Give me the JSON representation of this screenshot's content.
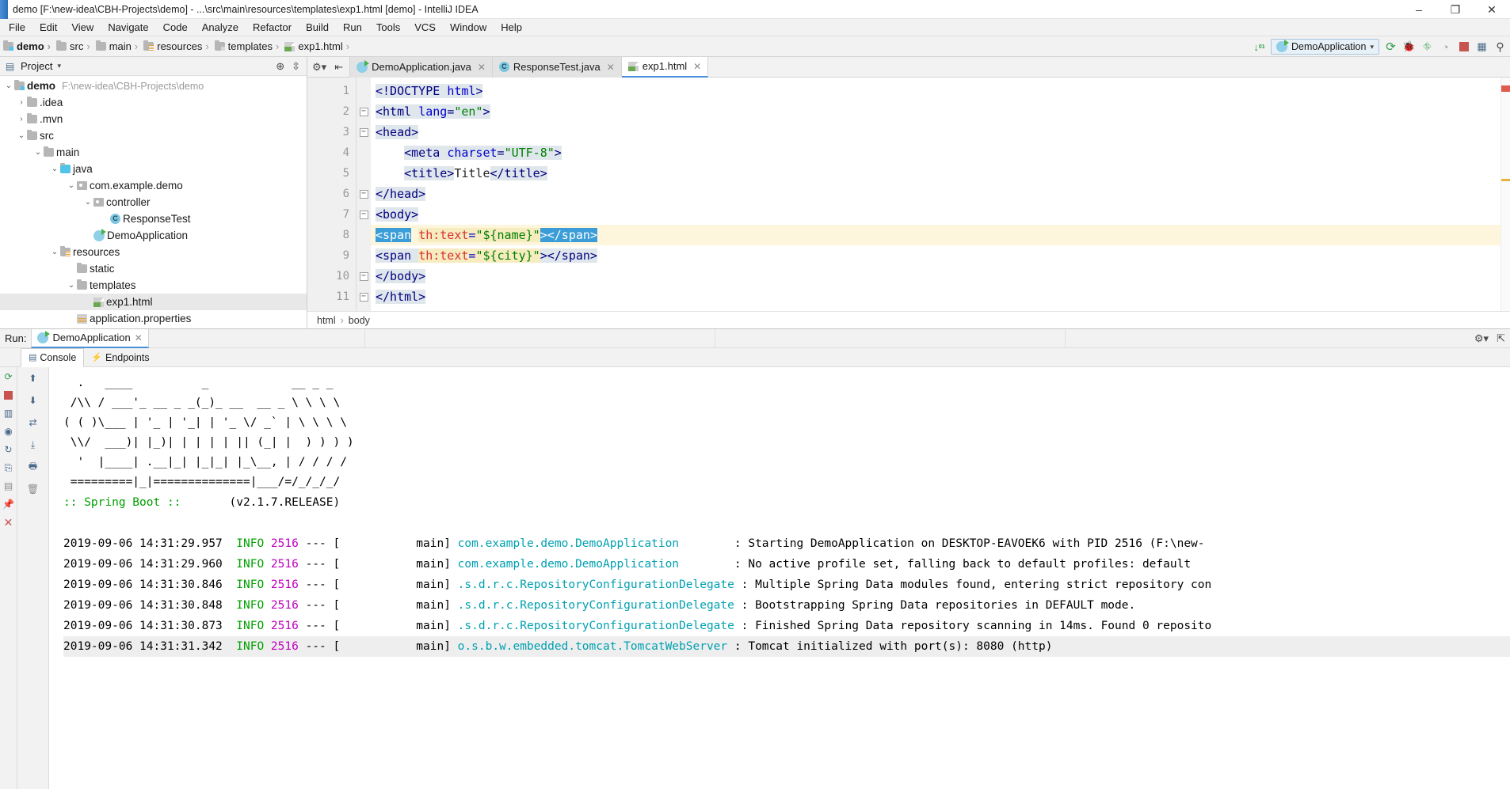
{
  "window": {
    "title": "demo [F:\\new-idea\\CBH-Projects\\demo] - ...\\src\\main\\resources\\templates\\exp1.html [demo] - IntelliJ IDEA",
    "minimize": "–",
    "maximize": "❐",
    "close": "✕"
  },
  "menubar": [
    "File",
    "Edit",
    "View",
    "Navigate",
    "Code",
    "Analyze",
    "Refactor",
    "Build",
    "Run",
    "Tools",
    "VCS",
    "Window",
    "Help"
  ],
  "breadcrumb": [
    {
      "label": "demo",
      "icon": "folder-module-icon"
    },
    {
      "label": "src",
      "icon": "folder-icon"
    },
    {
      "label": "main",
      "icon": "folder-icon"
    },
    {
      "label": "resources",
      "icon": "folder-resources-icon"
    },
    {
      "label": "templates",
      "icon": "folder-icon"
    },
    {
      "label": "exp1.html",
      "icon": "html-file-icon"
    }
  ],
  "toolbar": {
    "sort_icon": "sort-numeric-icon",
    "run_config": "DemoApplication",
    "run": "run-icon",
    "debug": "debug-icon",
    "coverage": "coverage-icon",
    "profile": "profile-icon",
    "stop": "stop-icon",
    "layout": "layout-icon",
    "search": "search-icon"
  },
  "project": {
    "title": "Project",
    "dropdown": "▾",
    "header_icons": [
      "target-icon",
      "collapse-all-icon"
    ],
    "tree": [
      {
        "label": "demo",
        "path": "F:\\new-idea\\CBH-Projects\\demo",
        "arrow": "⌄",
        "indent": 0,
        "icon": "folder-module-icon",
        "bold": true
      },
      {
        "label": ".idea",
        "arrow": "›",
        "indent": 1,
        "icon": "folder-icon"
      },
      {
        "label": ".mvn",
        "arrow": "›",
        "indent": 1,
        "icon": "folder-icon"
      },
      {
        "label": "src",
        "arrow": "⌄",
        "indent": 1,
        "icon": "folder-icon"
      },
      {
        "label": "main",
        "arrow": "⌄",
        "indent": 2,
        "icon": "folder-icon"
      },
      {
        "label": "java",
        "arrow": "⌄",
        "indent": 3,
        "icon": "folder-source-icon"
      },
      {
        "label": "com.example.demo",
        "arrow": "⌄",
        "indent": 4,
        "icon": "package-icon"
      },
      {
        "label": "controller",
        "arrow": "⌄",
        "indent": 5,
        "icon": "package-icon"
      },
      {
        "label": "ResponseTest",
        "arrow": "",
        "indent": 6,
        "icon": "java-class-icon"
      },
      {
        "label": "DemoApplication",
        "arrow": "",
        "indent": 5,
        "icon": "spring-boot-class-icon"
      },
      {
        "label": "resources",
        "arrow": "⌄",
        "indent": 3,
        "icon": "folder-resources-icon"
      },
      {
        "label": "static",
        "arrow": "",
        "indent": 4,
        "icon": "folder-icon"
      },
      {
        "label": "templates",
        "arrow": "⌄",
        "indent": 4,
        "icon": "folder-icon"
      },
      {
        "label": "exp1.html",
        "arrow": "",
        "indent": 5,
        "icon": "html-file-icon",
        "selected": true
      },
      {
        "label": "application.properties",
        "arrow": "",
        "indent": 4,
        "icon": "properties-file-icon"
      }
    ]
  },
  "editor": {
    "gear_icon": "gear-icon",
    "collapse_icon": "hide-panel-icon",
    "tabs": [
      {
        "label": "DemoApplication.java",
        "icon": "spring-boot-class-icon",
        "active": false,
        "close": "✕"
      },
      {
        "label": "ResponseTest.java",
        "icon": "java-class-icon",
        "active": false,
        "close": "✕"
      },
      {
        "label": "exp1.html",
        "icon": "html-file-icon",
        "active": true,
        "close": "✕"
      }
    ],
    "line_numbers": [
      "1",
      "2",
      "3",
      "4",
      "5",
      "6",
      "7",
      "8",
      "9",
      "10",
      "11"
    ],
    "code_lines": [
      "<!DOCTYPE html>",
      "<html lang=\"en\">",
      "<head>",
      "    <meta charset=\"UTF-8\">",
      "    <title>Title</title>",
      "</head>",
      "<body>",
      "<span th:text=\"${name}\"></span>",
      "<span th:text=\"${city}\"></span>",
      "</body>",
      "</html>"
    ],
    "current_line": 8,
    "status_breadcrumb": [
      "html",
      "body"
    ],
    "breadcrumb_sep": "›"
  },
  "run_panel": {
    "label": "Run:",
    "tab": "DemoApplication",
    "tab_close": "✕",
    "gear_icon": "settings-icon",
    "hide_icon": "hide-icon",
    "subtabs": [
      {
        "label": "Console",
        "icon": "console-icon",
        "active": true
      },
      {
        "label": "Endpoints",
        "icon": "endpoints-icon",
        "active": false
      }
    ],
    "rail_icons": [
      "rerun-icon",
      "up-arrow-icon",
      "down-arrow-icon",
      "pause-icon",
      "stop-icon",
      "trace-icon",
      "print-icon",
      "soft-wrap-icon",
      "scroll-to-end-icon",
      "pin-icon",
      "trash-icon",
      "close-icon"
    ],
    "banner": [
      "  .   ____          _            __ _ _",
      " /\\\\ / ___'_ __ _ _(_)_ __  __ _ \\ \\ \\ \\",
      "( ( )\\___ | '_ | '_| | '_ \\/ _` | \\ \\ \\ \\",
      " \\\\/  ___)| |_)| | | | | || (_| |  ) ) ) )",
      "  '  |____| .__|_| |_|_| |_\\__, | / / / /",
      " =========|_|==============|___/=/_/_/_/"
    ],
    "spring_line": ":: Spring Boot ::",
    "spring_version": "(v2.1.7.RELEASE)",
    "logs": [
      {
        "ts": "2019-09-06 14:31:29.957",
        "level": "INFO",
        "pid": "2516",
        "dash": "---",
        "thread": "main]",
        "logger": "com.example.demo.DemoApplication",
        "msg": "Starting DemoApplication on DESKTOP-EAVOEK6 with PID 2516 (F:\\new-"
      },
      {
        "ts": "2019-09-06 14:31:29.960",
        "level": "INFO",
        "pid": "2516",
        "dash": "---",
        "thread": "main]",
        "logger": "com.example.demo.DemoApplication",
        "msg": "No active profile set, falling back to default profiles: default"
      },
      {
        "ts": "2019-09-06 14:31:30.846",
        "level": "INFO",
        "pid": "2516",
        "dash": "---",
        "thread": "main]",
        "logger": ".s.d.r.c.RepositoryConfigurationDelegate",
        "msg": "Multiple Spring Data modules found, entering strict repository con"
      },
      {
        "ts": "2019-09-06 14:31:30.848",
        "level": "INFO",
        "pid": "2516",
        "dash": "---",
        "thread": "main]",
        "logger": ".s.d.r.c.RepositoryConfigurationDelegate",
        "msg": "Bootstrapping Spring Data repositories in DEFAULT mode."
      },
      {
        "ts": "2019-09-06 14:31:30.873",
        "level": "INFO",
        "pid": "2516",
        "dash": "---",
        "thread": "main]",
        "logger": ".s.d.r.c.RepositoryConfigurationDelegate",
        "msg": "Finished Spring Data repository scanning in 14ms. Found 0 reposito"
      },
      {
        "ts": "2019-09-06 14:31:31.342",
        "level": "INFO",
        "pid": "2516",
        "dash": "---",
        "thread": "main]",
        "logger": "o.s.b.w.embedded.tomcat.TomcatWebServer",
        "msg": "Tomcat initialized with port(s): 8080 (http)"
      }
    ],
    "bracket": "["
  },
  "colors": {
    "accent": "#4a90d9",
    "info_green": "#00a000",
    "pid_magenta": "#c000c0",
    "logger_cyan": "#00a0b0",
    "selection_blue": "#3b9dd8",
    "current_line": "#fdf6dd"
  }
}
